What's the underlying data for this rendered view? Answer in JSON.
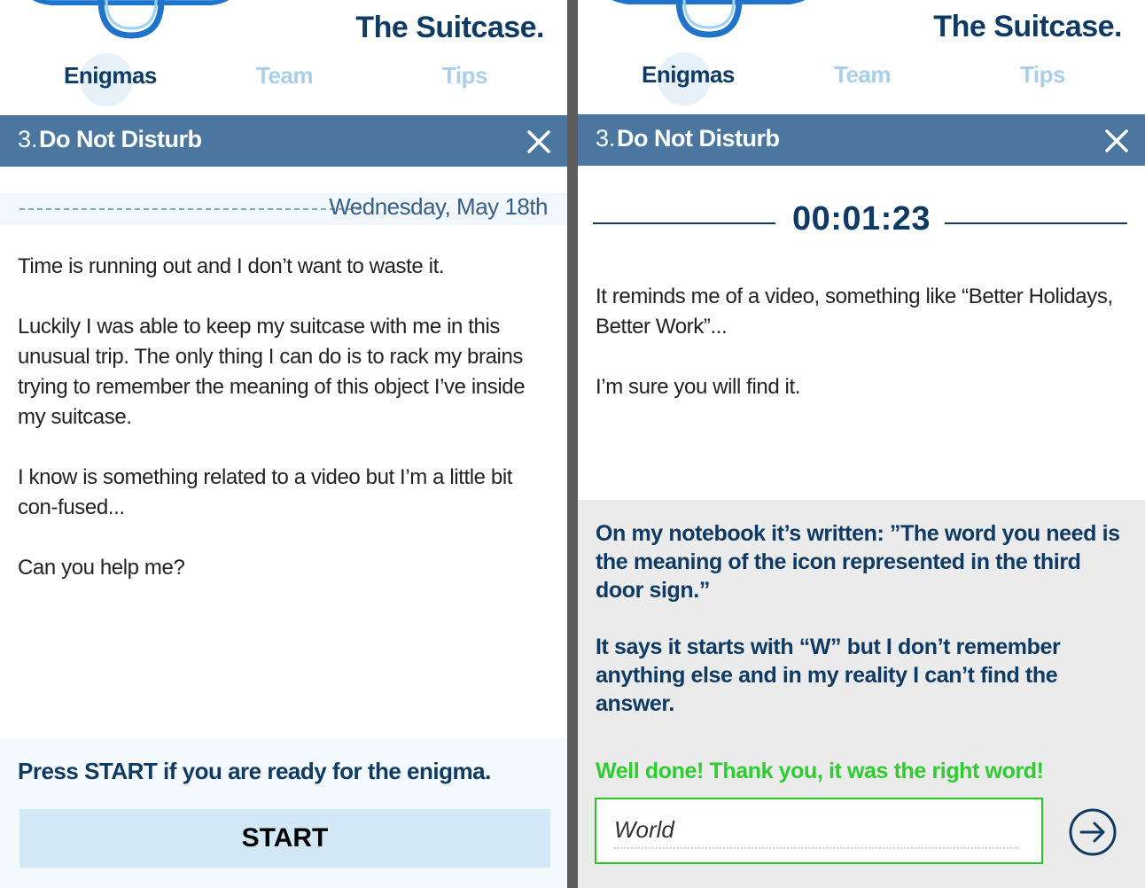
{
  "app": {
    "title": "The Suitcase.",
    "nav": [
      {
        "label": "Enigmas",
        "active": true
      },
      {
        "label": "Team",
        "active": false
      },
      {
        "label": "Tips",
        "active": false
      }
    ]
  },
  "left_panel": {
    "enigma": {
      "number": "3.",
      "title": "Do Not Disturb"
    },
    "date": "Wednesday, May 18th",
    "story": [
      "Time is running out and I don’t want to waste it.",
      "Luckily I was able to keep my suitcase with me in this unusual trip. The only thing I can do is to rack my brains trying to remember the meaning of this object I’ve inside my suitcase.",
      "I know is something related to a video but I’m a little bit con-fused...",
      "Can you help me?"
    ],
    "start_prompt": "Press START if you are ready for the enigma.",
    "start_label": "START"
  },
  "right_panel": {
    "enigma": {
      "number": "3.",
      "title": "Do Not Disturb"
    },
    "timer": "00:01:23",
    "story": [
      "It reminds me of a video, something like “Better Holidays, Better Work”...",
      "I’m sure you will find it."
    ],
    "hint": [
      "On my notebook it’s written: ”The word you need is the meaning of the icon represented in the third door sign.”",
      "It says it starts with “W” but I don’t remember anything else and in my reality I can’t find the answer."
    ],
    "success_message": "Well done! Thank you, it was the right word!",
    "answer_value": "World"
  },
  "colors": {
    "brand_dark": "#0e3a63",
    "title_bar": "#4a76a0",
    "nav_inactive": "#a9cfe9",
    "success": "#2ecc2e",
    "start_button": "#d2e8f6"
  },
  "icons": {
    "close": "close-icon",
    "submit": "arrow-right-circle-icon",
    "logo": "suitcase-logo"
  }
}
